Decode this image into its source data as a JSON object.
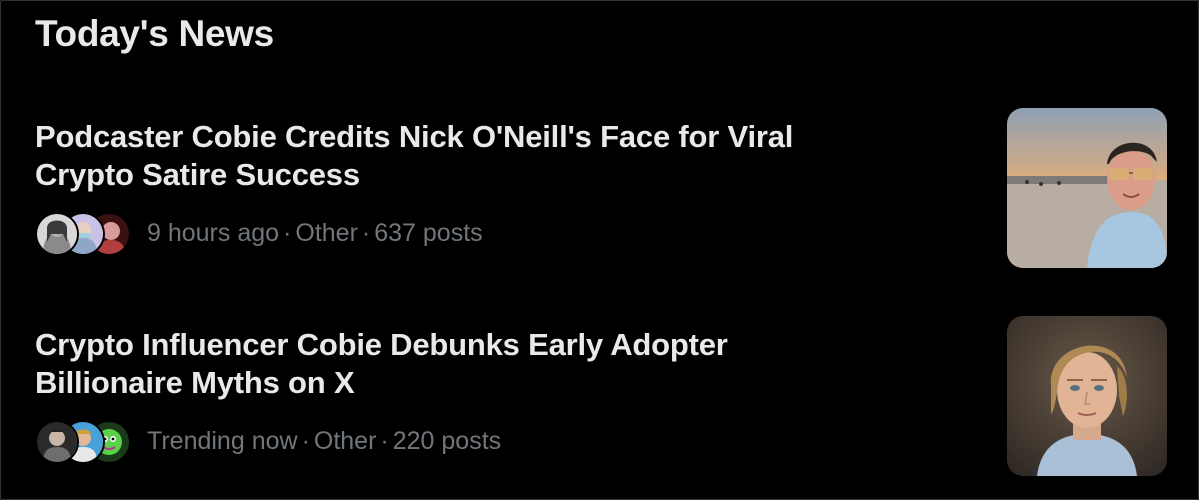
{
  "section": {
    "title": "Today's News"
  },
  "news": [
    {
      "headline_line1": "Podcaster Cobie Credits Nick O'Neill's Face for Viral",
      "headline_line2": "Crypto Satire Success",
      "time": "9 hours ago",
      "category": "Other",
      "posts": "637 posts",
      "thumbnail": "man-with-sunglasses-on-beach-photo",
      "avatars": [
        "user-avatar",
        "user-avatar",
        "user-avatar"
      ]
    },
    {
      "headline_line1": "Crypto Influencer Cobie Debunks Early Adopter",
      "headline_line2": "Billionaire Myths on X",
      "time": "Trending now",
      "category": "Other",
      "posts": "220 posts",
      "thumbnail": "young-man-portrait-photo",
      "avatars": [
        "user-avatar",
        "user-avatar",
        "user-avatar"
      ]
    }
  ],
  "separator": "·",
  "colors": {
    "background": "#000000",
    "primary_text": "#e7e9ea",
    "secondary_text": "#71767b"
  }
}
